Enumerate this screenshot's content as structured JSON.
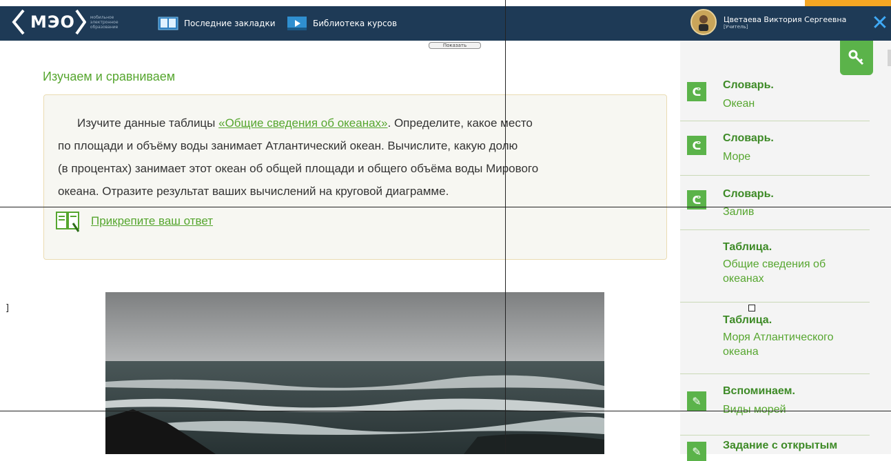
{
  "header": {
    "logo_text": "МЭО",
    "logo_sub": "мобильное электронное образование",
    "nav": [
      {
        "label": "Последние закладки",
        "icon": "open-book-icon"
      },
      {
        "label": "Библиотека курсов",
        "icon": "video-library-icon"
      }
    ],
    "user_name": "Цветаева Виктория Сергеевна",
    "user_role": "[Учитель]",
    "close_icon": "close-icon",
    "accent_close": "#3fa9f5",
    "bar_color": "#1e3a56"
  },
  "main": {
    "show_button": "Показать",
    "title": "Изучаем и сравниваем",
    "task_lines": {
      "line1_before": "Изучите данные таблицы ",
      "link": "«Общие сведения об океанах»",
      "line1_after": ". Определите, какое место",
      "line2": "по площади и объёму воды занимает Атлантический океан. Вычислите, какую долю",
      "line3": "(в процентах) занимает этот океан об общей площади и общего объёма воды Мирового",
      "line4": "океана. Отразите результат ваших вычислений на круговой диаграмме."
    },
    "attach_label": "Прикрепите ваш ответ",
    "accent_green": "#56a62f"
  },
  "sidebar": {
    "items": [
      {
        "title": "Словарь.",
        "sub": "Океан",
        "icon": "link-icon"
      },
      {
        "title": "Словарь.",
        "sub": "Море",
        "icon": "link-icon"
      },
      {
        "title": "Словарь.",
        "sub": "Залив",
        "icon": "link-icon"
      },
      {
        "title": "Таблица.",
        "sub": "Общие сведения об океанах",
        "icon": ""
      },
      {
        "title": "Таблица.",
        "sub": "Моря Атлантического океана",
        "icon": ""
      },
      {
        "title": "Вспоминаем.",
        "sub": "Виды морей",
        "icon": "pencil-icon"
      },
      {
        "title": "Задание с открытым",
        "sub": "",
        "icon": "pencil-icon"
      }
    ]
  }
}
